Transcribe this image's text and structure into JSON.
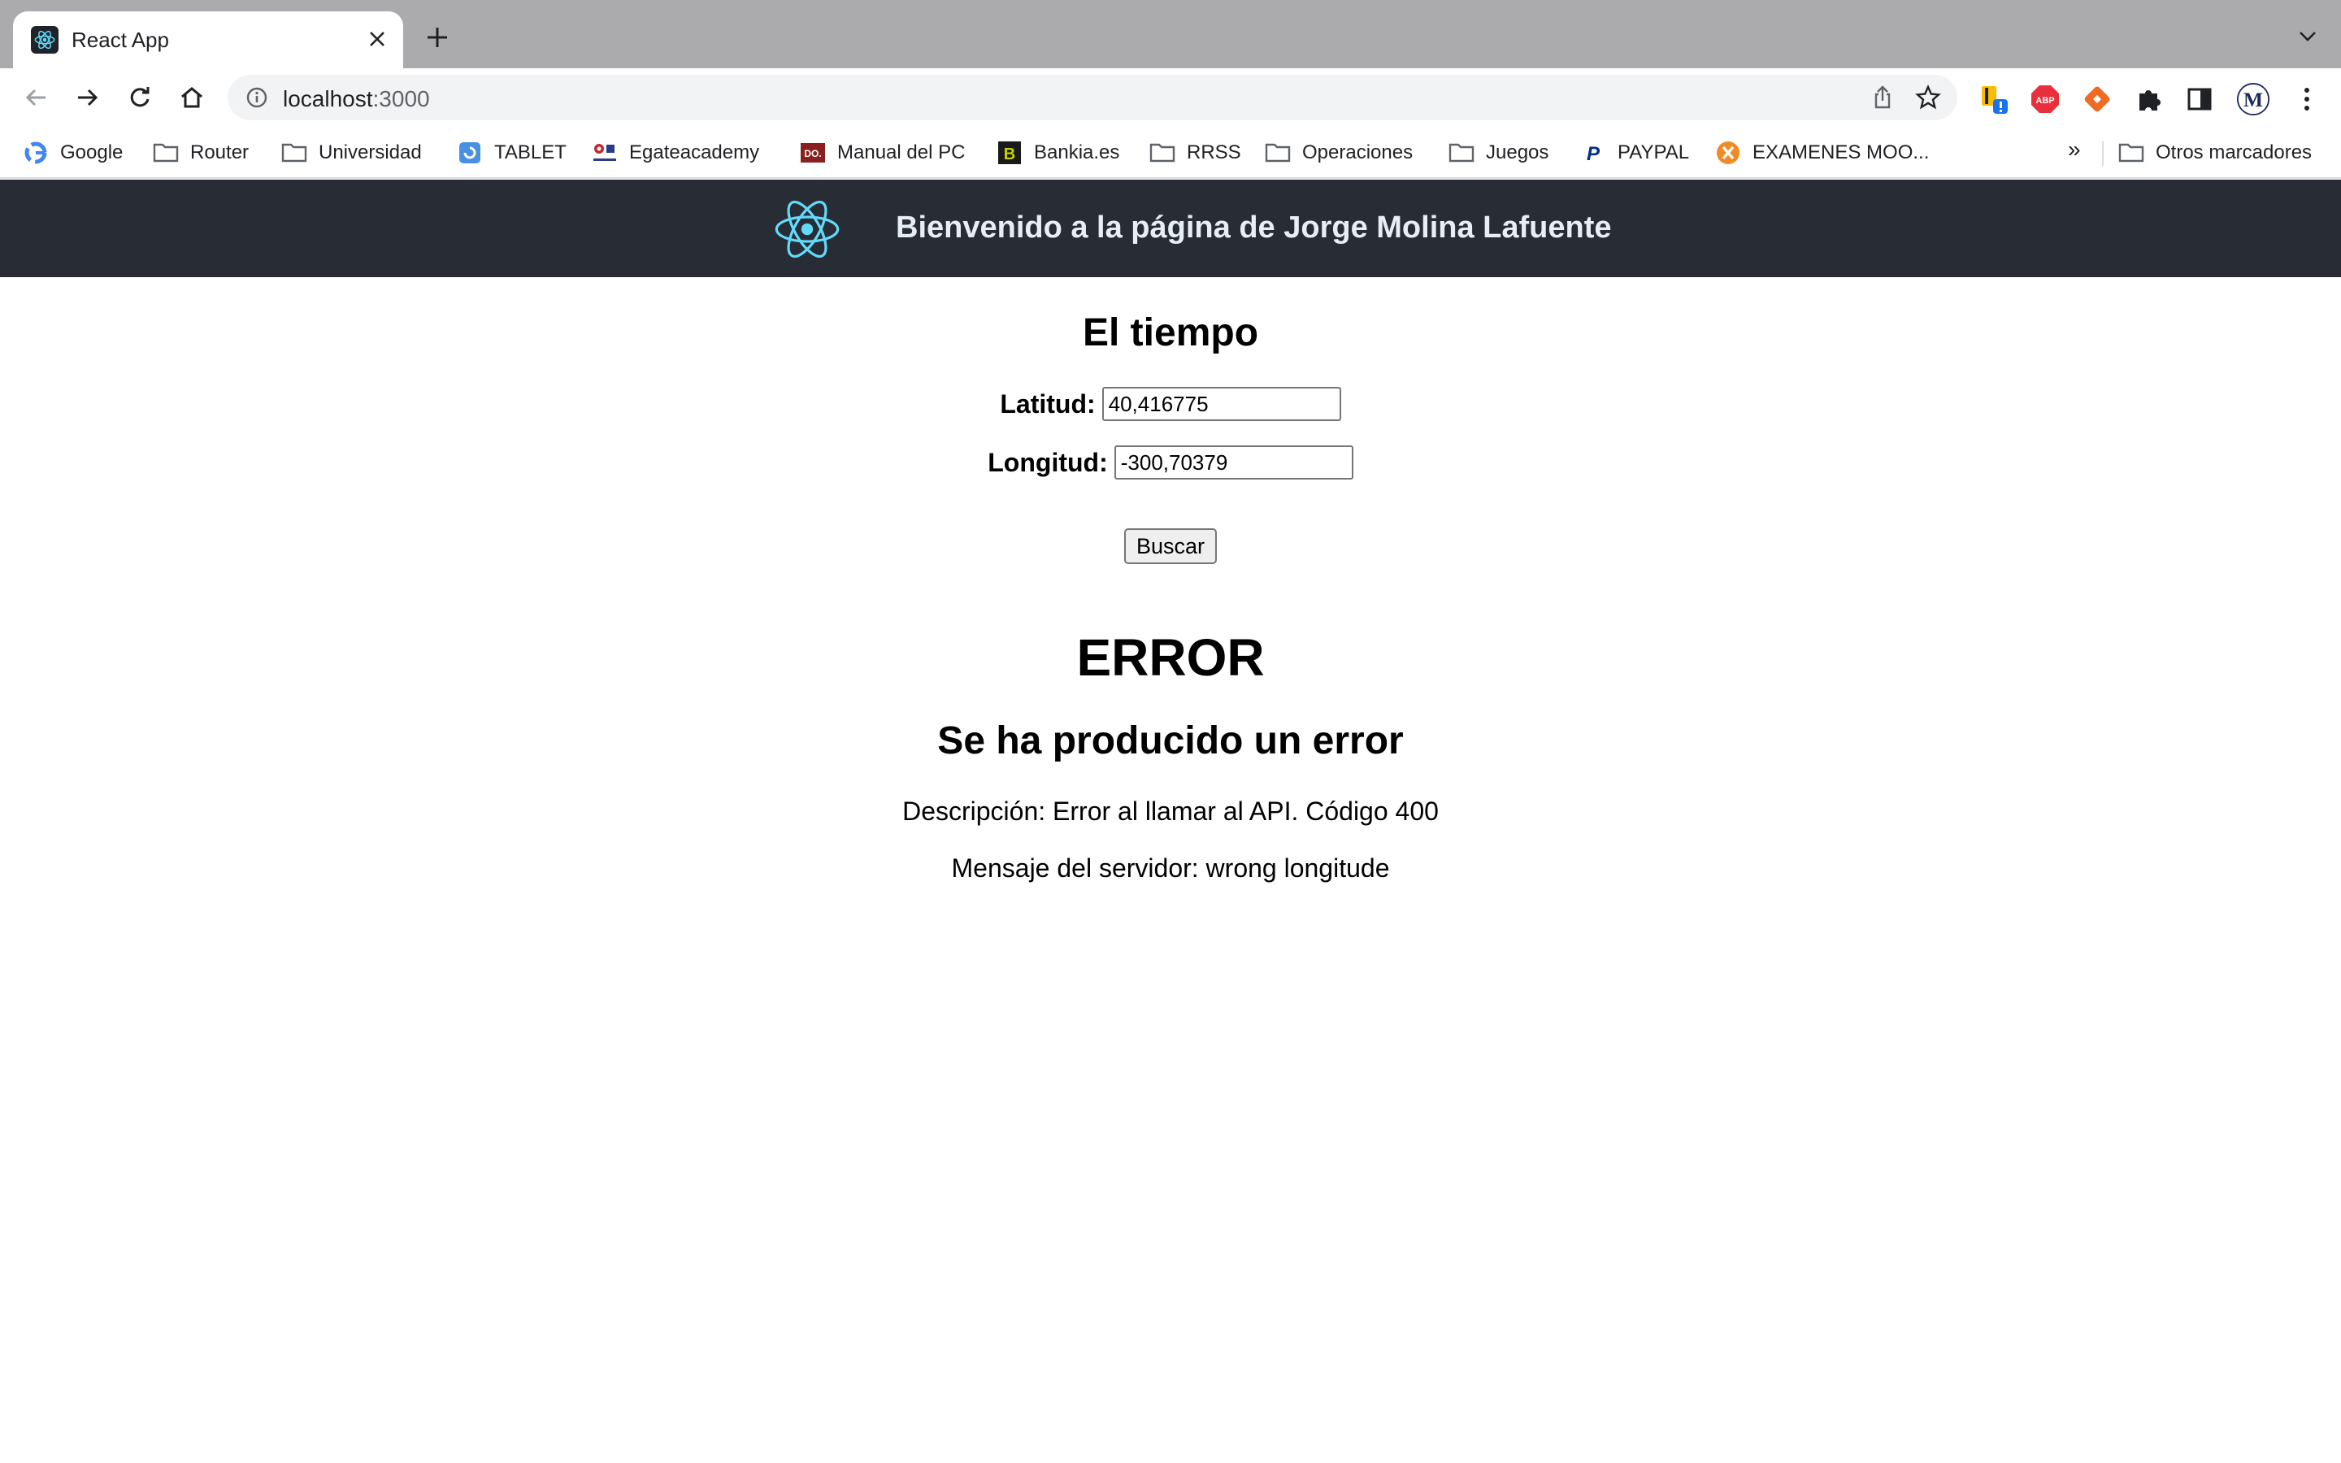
{
  "browser": {
    "tab": {
      "title": "React App"
    },
    "address": {
      "host": "localhost",
      "port": ":3000"
    },
    "bookmarks": [
      {
        "label": "Google",
        "icon": "google-icon"
      },
      {
        "label": "Router",
        "icon": "folder-icon"
      },
      {
        "label": "Universidad",
        "icon": "folder-icon"
      },
      {
        "label": "TABLET",
        "icon": "site-icon"
      },
      {
        "label": "Egateacademy",
        "icon": "site-icon"
      },
      {
        "label": "Manual del PC",
        "icon": "site-icon"
      },
      {
        "label": "Bankia.es",
        "icon": "site-icon"
      },
      {
        "label": "RRSS",
        "icon": "folder-icon"
      },
      {
        "label": "Operaciones",
        "icon": "folder-icon"
      },
      {
        "label": "Juegos",
        "icon": "folder-icon"
      },
      {
        "label": "PAYPAL",
        "icon": "paypal-icon"
      },
      {
        "label": "EXAMENES MOO...",
        "icon": "site-icon"
      }
    ],
    "bookmarks_more": "»",
    "other_bookmarks": "Otros marcadores",
    "extensions": {
      "abp_label": "ABP",
      "avatar_letter": "M"
    }
  },
  "page": {
    "header_title": "Bienvenido a la página de Jorge Molina Lafuente",
    "heading": "El tiempo",
    "latitude": {
      "label": "Latitud:",
      "value": "40,416775"
    },
    "longitude": {
      "label": "Longitud:",
      "value": "-300,70379"
    },
    "search_button": "Buscar",
    "error": {
      "title": "ERROR",
      "subtitle": "Se ha producido un error",
      "description": "Descripción: Error al llamar al API. Código 400",
      "server_message": "Mensaje del servidor: wrong longitude"
    }
  },
  "colors": {
    "header_bg": "#282c34",
    "react_logo": "#61dafb",
    "tabstrip_bg": "#ababad"
  }
}
